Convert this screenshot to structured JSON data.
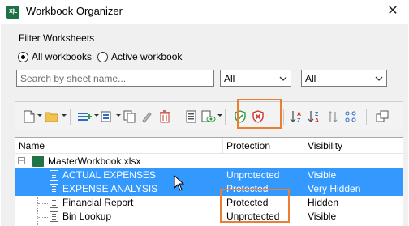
{
  "window": {
    "title": "Workbook Organizer",
    "app_icon": "excel-icon",
    "close_glyph": "✕",
    "app_icon_label": "X|L"
  },
  "filter": {
    "title": "Filter Worksheets",
    "radios": [
      {
        "label": "All workbooks",
        "checked": true
      },
      {
        "label": "Active workbook",
        "checked": false
      }
    ],
    "search_placeholder": "Search by sheet name...",
    "protection_filter": "All",
    "visibility_filter": "All"
  },
  "toolbar": {
    "icons": [
      "new-sheet-icon",
      "open-folder-icon",
      "insert-sheets-icon",
      "copy-move-icon",
      "duplicate-icon",
      "rename-icon",
      "delete-icon",
      "print-preview-icon",
      "visibility-icon",
      "protect-icon",
      "unprotect-icon",
      "sort-az-icon",
      "sort-za-icon",
      "reverse-icon",
      "shuffle-icon",
      "switch-window-icon"
    ],
    "highlight_color": "#ec7e31"
  },
  "grid": {
    "columns": [
      "Name",
      "Protection",
      "Visibility"
    ],
    "workbook": {
      "name": "MasterWorkbook.xlsx",
      "expander": "−"
    },
    "rows": [
      {
        "name": "ACTUAL EXPENSES",
        "protection": "Unprotected",
        "visibility": "Visible",
        "selected": true
      },
      {
        "name": "EXPENSE ANALYSIS",
        "protection": "Protected",
        "visibility": "Very Hidden",
        "selected": true
      },
      {
        "name": "Financial Report",
        "protection": "Protected",
        "visibility": "Hidden",
        "selected": false
      },
      {
        "name": "Bin Lookup",
        "protection": "Unprotected",
        "visibility": "Visible",
        "selected": false
      }
    ],
    "selection_color": "#3399ff"
  }
}
